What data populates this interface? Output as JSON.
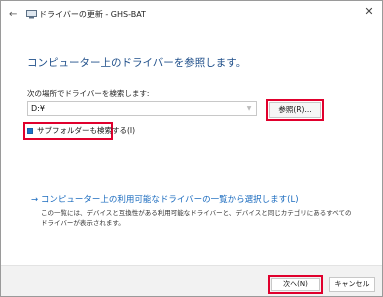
{
  "titlebar": {
    "back_icon": "←",
    "title": "ドライバーの更新 - GHS-BAT",
    "close_icon": "✕"
  },
  "main": {
    "heading": "コンピューター上のドライバーを参照します。",
    "search_label": "次の場所でドライバーを検索します:",
    "path_value": "D:¥",
    "browse_label": "参照(R)...",
    "include_subfolders_label": "サブフォルダーも検索する(I)",
    "include_subfolders_checked": true,
    "choose_link": "→  コンピューター上の利用可能なドライバーの一覧から選択します(L)",
    "choose_description": "この一覧には、デバイスと互換性がある利用可能なドライバーと、デバイスと同じカテゴリにあるすべてのドライバーが表示されます。"
  },
  "footer": {
    "next_label": "次へ(N)",
    "cancel_label": "キャンセル"
  },
  "colors": {
    "heading": "#1f4f8a",
    "link": "#1a6bbf",
    "highlight": "#e0002d",
    "checkbox": "#1a73c9"
  }
}
